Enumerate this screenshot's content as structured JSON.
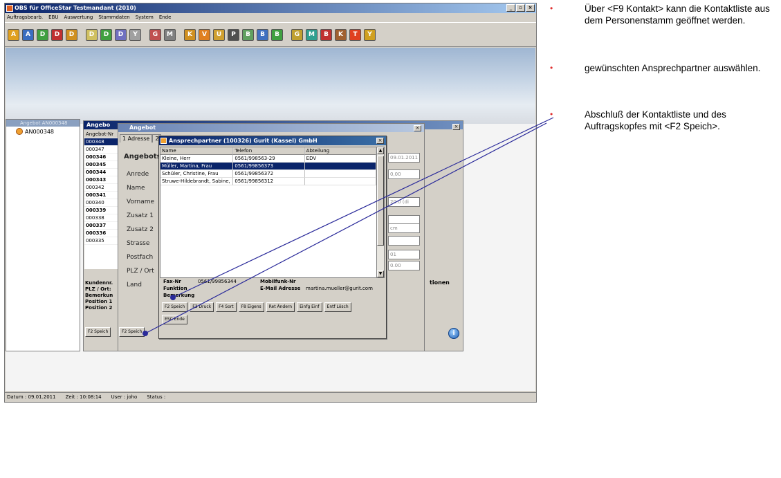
{
  "window": {
    "title": "OBS für  OfficeStar Testmandant (2010)",
    "controls": [
      "_",
      "▫",
      "×"
    ]
  },
  "menu": [
    "Auftragsbearb.",
    "EBU",
    "Auswertung",
    "Stammdaten",
    "System",
    "Ende"
  ],
  "toolbar_icons": [
    "A",
    "A",
    "D",
    "D",
    "D",
    "D",
    "D",
    "D",
    "Y",
    "G",
    "M",
    "K",
    "V",
    "U",
    "P",
    "B",
    "B",
    "B",
    "G",
    "M",
    "B",
    "K",
    "T",
    "Y"
  ],
  "tree": {
    "header": "Angebot AN000348",
    "node": "AN000348"
  },
  "angebot_list": {
    "title": "Angebo",
    "header": "Angebot-Nr",
    "items": [
      {
        "text": "000348",
        "bold": false,
        "selected": true
      },
      {
        "text": "000347",
        "bold": false,
        "selected": false
      },
      {
        "text": "000346",
        "bold": true,
        "selected": false
      },
      {
        "text": "000345",
        "bold": true,
        "selected": false
      },
      {
        "text": "000344",
        "bold": true,
        "selected": false
      },
      {
        "text": "000343",
        "bold": true,
        "selected": false
      },
      {
        "text": "000342",
        "bold": false,
        "selected": false
      },
      {
        "text": "000341",
        "bold": true,
        "selected": false
      },
      {
        "text": "000340",
        "bold": false,
        "selected": false
      },
      {
        "text": "000339",
        "bold": true,
        "selected": false
      },
      {
        "text": "000338",
        "bold": false,
        "selected": false
      },
      {
        "text": "000337",
        "bold": true,
        "selected": false
      },
      {
        "text": "000336",
        "bold": true,
        "selected": false
      },
      {
        "text": "000335",
        "bold": false,
        "selected": false
      }
    ],
    "info_labels": [
      "Kundennr.",
      "PLZ / Ort:",
      "Bemerkun",
      "Position 1",
      "Position 2"
    ],
    "button": "F2 Speich"
  },
  "angebot_dialog": {
    "title": "Angebot",
    "tabs": [
      "1 Adresse",
      "2"
    ],
    "section_title": "Angebots",
    "labels": [
      "Anrede",
      "Name",
      "Vorname",
      "Zusatz 1",
      "Zusatz 2",
      "Strasse",
      "Postfach",
      "PLZ / Ort",
      "Land"
    ],
    "button": "F2 Speich",
    "right_values": [
      "09.01.2011",
      "0,00",
      "20.0 (di",
      "",
      "cm",
      "",
      "01",
      "0.00"
    ],
    "positions_label": "tionen",
    "info_button": "i"
  },
  "contact_dialog": {
    "title": "Ansprechpartner (100326) Gurit (Kassel) GmbH",
    "columns": [
      "Name",
      "Telefon",
      "Abteilung"
    ],
    "rows": [
      {
        "name": "Kleine, Herr",
        "telefon": "0561/998563-29",
        "abteilung": "EDV",
        "selected": false
      },
      {
        "name": "Müller, Martina, Frau",
        "telefon": "0561/99856373",
        "abteilung": "",
        "selected": true
      },
      {
        "name": "Schüler, Christine, Frau",
        "telefon": "0561/99856372",
        "abteilung": "",
        "selected": false
      },
      {
        "name": "Struwe-Hildebrandt, Sabine,",
        "telefon": "0561/99856312",
        "abteilung": "",
        "selected": false
      }
    ],
    "fax_label": "Fax-Nr",
    "fax_value": "0561/99856344",
    "mobil_label": "Mobilfunk-Nr",
    "funktion_label": "Funktion",
    "email_label": "E-Mail Adresse",
    "email_value": "martina.mueller@gurit.com",
    "bemerkung_label": "Bemerkung",
    "buttons": [
      "F2 Speich",
      "F3 Druck",
      "F4 Sort",
      "F8 Eigens",
      "Ret Ändern",
      "Einfg Einf",
      "Entf Lösch"
    ],
    "esc_button": "ESC Ende"
  },
  "statusbar": {
    "datum": "Datum : 09.01.2011",
    "zeit": "Zeit : 10:08:14",
    "user": "User : joho",
    "status": "Status :"
  },
  "instructions": [
    "Über <F9 Kontakt> kann die Kontaktliste aus dem Personenstamm geöffnet werden.",
    "gewünschten Ansprechpartner auswählen.",
    "Abschluß der Kontaktliste und des Auftragskopfes mit <F2 Speich>."
  ],
  "bullet_char": "•",
  "colors": {
    "accent_line": "#2a2a9a",
    "bullet": "#e03030",
    "selection": "#0a246a"
  }
}
